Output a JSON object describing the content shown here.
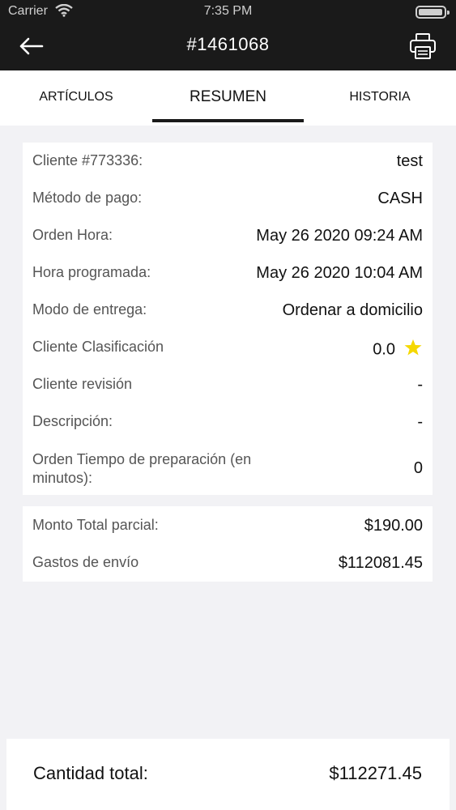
{
  "status_bar": {
    "carrier": "Carrier",
    "time": "7:35 PM"
  },
  "header": {
    "title": "#1461068",
    "back_icon": "arrow-left-icon",
    "print_icon": "printer-icon"
  },
  "tabs": [
    {
      "label": "ARTÍCULOS",
      "active": false
    },
    {
      "label": "RESUMEN",
      "active": true
    },
    {
      "label": "HISTORIA",
      "active": false
    }
  ],
  "summary": {
    "rows": [
      {
        "label": "Cliente #773336:",
        "value": "test"
      },
      {
        "label": "Método de pago:",
        "value": "CASH"
      },
      {
        "label": "Orden Hora:",
        "value": "May 26 2020 09:24 AM"
      },
      {
        "label": "Hora programada:",
        "value": "May 26 2020 10:04 AM"
      },
      {
        "label": "Modo de entrega:",
        "value": "Ordenar a domicilio"
      },
      {
        "label": "Cliente Clasificación",
        "value": "0.0"
      },
      {
        "label": "Cliente revisión",
        "value": "-"
      },
      {
        "label": "Descripción:",
        "value": "-"
      },
      {
        "label": "Orden Tiempo de preparación (en minutos):",
        "value": "0"
      }
    ]
  },
  "charges": {
    "rows": [
      {
        "label": "Monto Total parcial:",
        "value": "$190.00"
      },
      {
        "label": "Gastos de envío",
        "value": "$112081.45"
      }
    ]
  },
  "total": {
    "label": "Cantidad total:",
    "value": "$112271.45"
  },
  "colors": {
    "header_bg": "#1a1a1a",
    "star": "#f5d800",
    "page_bg": "#f2f2f5"
  }
}
